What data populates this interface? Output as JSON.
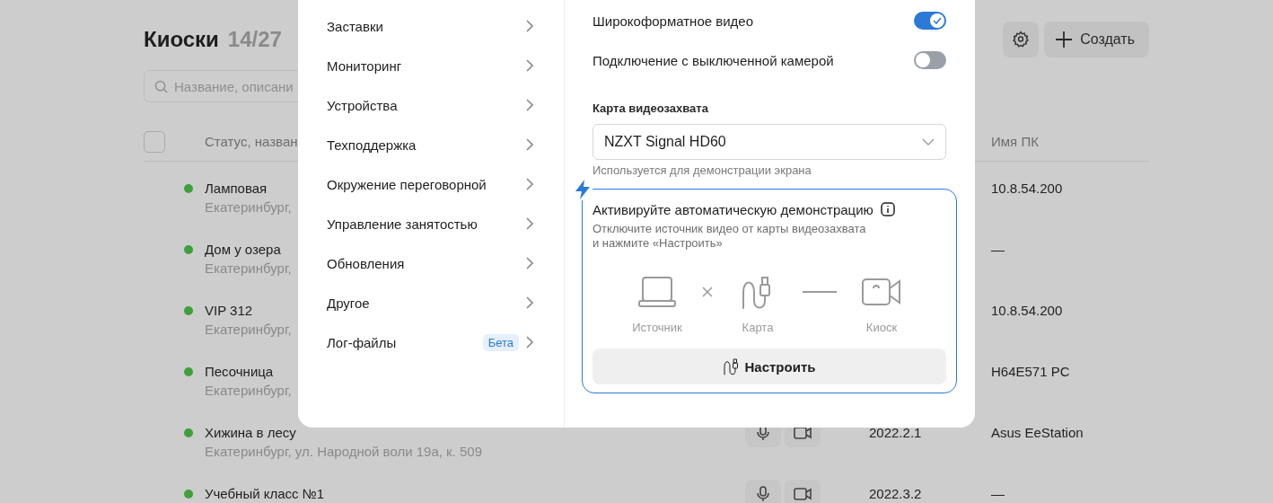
{
  "page": {
    "title": "Киоски",
    "count": "14/27",
    "search": {
      "placeholder": "Название, описани"
    },
    "actions": {
      "create": "Создать"
    },
    "table": {
      "columns": [
        "Статус, назван",
        "Имя ПК"
      ],
      "select_all": {
        "checked": false
      },
      "rows": [
        {
          "name": "Ламповая",
          "address": "Екатеринбург,",
          "online": true,
          "pc_name": "10.8.54.200"
        },
        {
          "name": "Дом у озера",
          "address": "Екатеринбург,",
          "online": true,
          "pc_name": "—"
        },
        {
          "name": "VIP 312",
          "address": "Екатеринбург,",
          "online": true,
          "pc_name": "10.8.54.200"
        },
        {
          "name": "Песочница",
          "address": "Екатеринбург,",
          "online": true,
          "pc_name": "H64E571 PC"
        },
        {
          "name": "Хижина в лесу",
          "address": "Екатеринбург, ул. Народной воли 19а, к. 509",
          "online": true,
          "mic_button": true,
          "camera_button": true,
          "version": "2022.2.1",
          "pc_name": "Asus EeStation"
        },
        {
          "name": "Учебный класс №1",
          "online": true,
          "mic_button": true,
          "camera_button": true,
          "version": "2022.3.2",
          "pc_name": "—"
        }
      ]
    }
  },
  "dialog": {
    "nav": [
      {
        "label": "Заставки"
      },
      {
        "label": "Мониторинг"
      },
      {
        "label": "Устройства"
      },
      {
        "label": "Техподдержка"
      },
      {
        "label": "Окружение переговорной"
      },
      {
        "label": "Управление занятостью"
      },
      {
        "label": "Обновления"
      },
      {
        "label": "Другое"
      },
      {
        "label": "Лог-файлы",
        "badge": "Бета"
      }
    ],
    "toggles": [
      {
        "label": "Широкоформатное видео",
        "on": true
      },
      {
        "label": "Подключение с выключенной камерой",
        "on": false
      }
    ],
    "capture": {
      "label": "Карта видеозахвата",
      "value": "NZXT Signal HD60",
      "hint": "Используется для демонстрации экрана"
    },
    "auto_demo": {
      "title": "Активируйте автоматическую демонстрацию",
      "description": "Отключите источник видео от карты видеозахвата\nи нажмите «Настроить»",
      "steps": [
        {
          "kind": "source",
          "label": "Источник",
          "connected": false
        },
        {
          "kind": "card",
          "label": "Карта",
          "connected": true
        },
        {
          "kind": "kiosk",
          "label": "Киоск"
        }
      ],
      "button": "Настроить"
    }
  }
}
